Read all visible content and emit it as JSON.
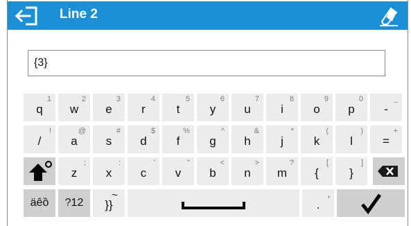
{
  "header": {
    "title": "Line 2",
    "back_icon": "back-arrow-icon",
    "eraser_icon": "eraser-icon",
    "color": "#1d8fd6"
  },
  "input": {
    "value": "{3}"
  },
  "keyboard": {
    "rows": [
      [
        {
          "main": "q",
          "sub": "1"
        },
        {
          "main": "w",
          "sub": "2"
        },
        {
          "main": "e",
          "sub": "3"
        },
        {
          "main": "r",
          "sub": "4"
        },
        {
          "main": "t",
          "sub": "5"
        },
        {
          "main": "y",
          "sub": "6"
        },
        {
          "main": "u",
          "sub": "7"
        },
        {
          "main": "i",
          "sub": "8"
        },
        {
          "main": "o",
          "sub": "9"
        },
        {
          "main": "p",
          "sub": "0"
        },
        {
          "main": "-",
          "sub": "_"
        }
      ],
      [
        {
          "main": "/",
          "sub": "!"
        },
        {
          "main": "a",
          "sub": "@"
        },
        {
          "main": "s",
          "sub": "#"
        },
        {
          "main": "d",
          "sub": "$"
        },
        {
          "main": "f",
          "sub": "%"
        },
        {
          "main": "g",
          "sub": "^"
        },
        {
          "main": "h",
          "sub": "&"
        },
        {
          "main": "j",
          "sub": "*"
        },
        {
          "main": "k",
          "sub": "("
        },
        {
          "main": "l",
          "sub": ")"
        },
        {
          "main": "=",
          "sub": "+"
        }
      ],
      [
        {
          "main": "z",
          "sub": ";"
        },
        {
          "main": "x",
          "sub": ":"
        },
        {
          "main": "c",
          "sub": "'"
        },
        {
          "main": "v",
          "sub": "\""
        },
        {
          "main": "b",
          "sub": "<"
        },
        {
          "main": "n",
          "sub": ">"
        },
        {
          "main": "m",
          "sub": "?"
        },
        {
          "main": "{",
          "sub": "["
        },
        {
          "main": "}",
          "sub": "]"
        }
      ]
    ],
    "shift_icon": "shift-arrow-icon",
    "backspace_icon": "backspace-icon",
    "accents_label": "äêȍ",
    "symbols_label": "?12",
    "bracket_tilde_main": "}}",
    "bracket_tilde_sub": "~",
    "space_icon": "spacebar-icon",
    "period_main": ".",
    "period_sub": ",",
    "enter_icon": "checkmark-icon"
  }
}
